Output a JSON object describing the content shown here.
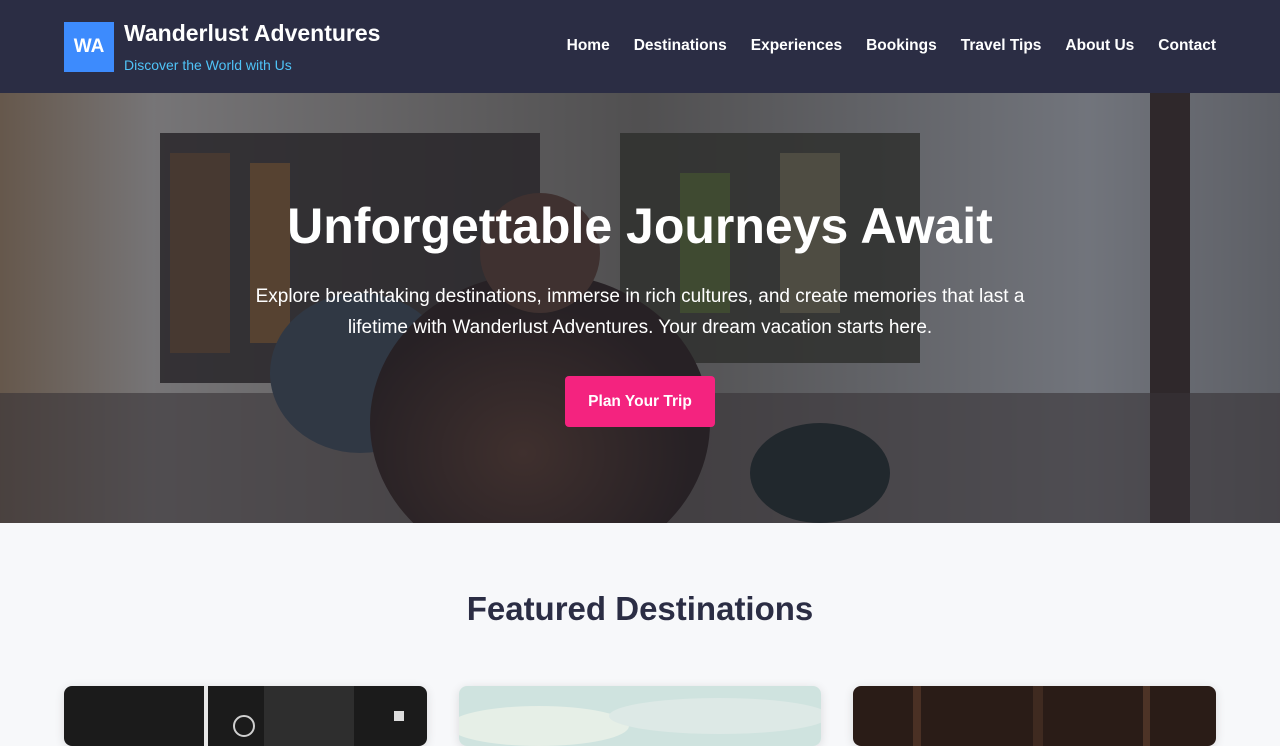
{
  "header": {
    "logo_text": "WA",
    "brand_title": "Wanderlust Adventures",
    "tagline": "Discover the World with Us",
    "nav": [
      "Home",
      "Destinations",
      "Experiences",
      "Bookings",
      "Travel Tips",
      "About Us",
      "Contact"
    ]
  },
  "hero": {
    "title": "Unforgettable Journeys Await",
    "text": "Explore breathtaking destinations, immerse in rich cultures, and create memories that last a lifetime with Wanderlust Adventures. Your dream vacation starts here.",
    "cta_label": "Plan Your Trip"
  },
  "featured": {
    "title": "Featured Destinations",
    "cards": [
      {
        "image": "city-night-photo"
      },
      {
        "image": "sky-landscape-photo"
      },
      {
        "image": "forest-dusk-photo"
      }
    ]
  },
  "colors": {
    "header_bg": "#2b2d44",
    "logo_bg": "#3d8bfd",
    "tagline": "#4fc3f7",
    "cta": "#f4237f",
    "page_bg": "#f7f8fa"
  }
}
